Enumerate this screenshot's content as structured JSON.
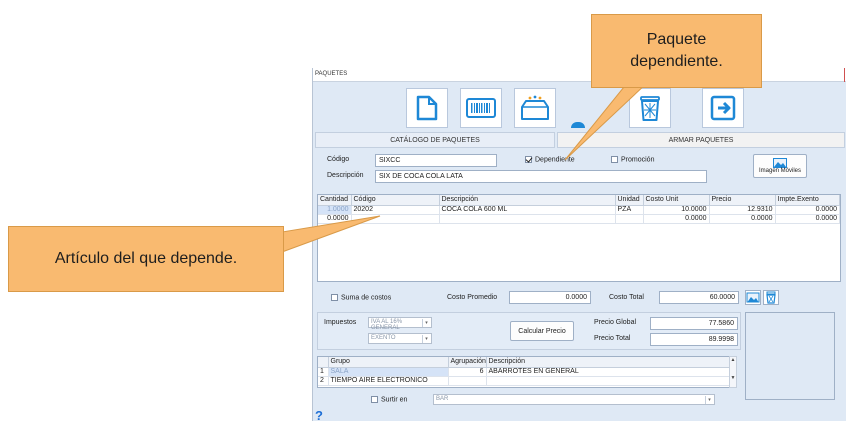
{
  "window": {
    "title": "PAQUETES"
  },
  "toolbar": {
    "buttons": [
      {
        "icon": "new-document-icon"
      },
      {
        "icon": "barcode-icon"
      },
      {
        "icon": "package-icon"
      },
      {
        "icon": "edit-icon"
      },
      {
        "icon": "trash-icon"
      },
      {
        "icon": "exit-icon"
      }
    ]
  },
  "tabs": {
    "catalog": "CATÁLOGO DE PAQUETES",
    "assemble": "ARMAR PAQUETES"
  },
  "form": {
    "codigo_label": "Código",
    "codigo_value": "SIXCC",
    "descripcion_label": "Descripción",
    "descripcion_value": "SIX DE COCA COLA LATA",
    "dependiente_label": "Dependiente",
    "dependiente_checked": true,
    "promocion_label": "Promoción",
    "promocion_checked": false,
    "imagen_button": "Imagen Móviles"
  },
  "items_table": {
    "headers": [
      "Cantidad",
      "Código",
      "Descripción",
      "Unidad",
      "Costo Unit",
      "Precio",
      "Impte.Exento"
    ],
    "rows": [
      [
        "1.0000",
        "20202",
        "COCA COLA 600 ML",
        "PZA",
        "10.0000",
        "12.9310",
        "0.0000"
      ],
      [
        "0.0000",
        "",
        "",
        "",
        "0.0000",
        "0.0000",
        "0.0000"
      ]
    ]
  },
  "totals": {
    "suma_costos_label": "Suma de costos",
    "costo_promedio_label": "Costo Promedio",
    "costo_promedio_value": "0.0000",
    "costo_total_label": "Costo Total",
    "costo_total_value": "60.0000"
  },
  "taxes": {
    "impuestos_label": "Impuestos",
    "impuesto1": "IVA AL 16% GENERAL",
    "impuesto2": "EXENTO",
    "calcular_button": "Calcular Precio",
    "precio_global_label": "Precio Global",
    "precio_global_value": "77.5860",
    "precio_total_label": "Precio Total",
    "precio_total_value": "89.9998"
  },
  "groups_table": {
    "headers": [
      "",
      "Grupo",
      "Agrupación",
      "Descripción"
    ],
    "rows": [
      [
        "1",
        "SALA",
        "6",
        "ABARROTES EN GENERAL"
      ],
      [
        "2",
        "TIEMPO AIRE ELECTRONICO",
        "",
        ""
      ]
    ]
  },
  "footer": {
    "surtir_label": "Surtir en",
    "surtir_value": "BAR",
    "help_symbol": "?"
  },
  "callouts": {
    "dependent_package": "Paquete dependiente.",
    "article": "Artículo del que depende."
  },
  "colors": {
    "callout": "#f9ba70",
    "window_bg": "#dfe9f5",
    "icon_blue": "#1e88d6"
  }
}
